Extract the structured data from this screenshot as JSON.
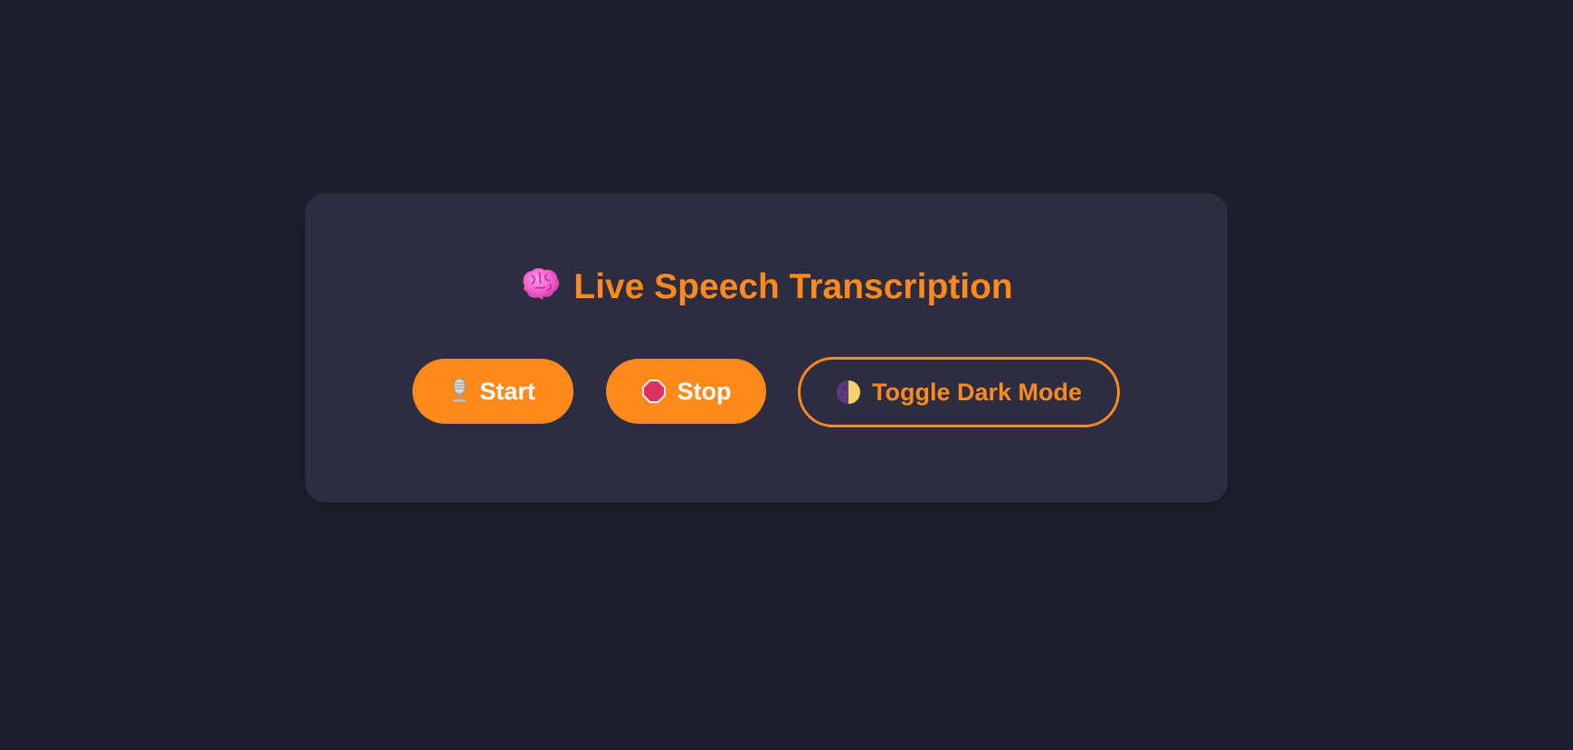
{
  "app": {
    "title": "Live Speech Transcription"
  },
  "title_icon": "brain-icon",
  "controls": {
    "start": {
      "label": "Start",
      "icon": "microphone-icon"
    },
    "stop": {
      "label": "Stop",
      "icon": "stop-sign-icon"
    },
    "toggle": {
      "label": "Toggle Dark Mode",
      "icon": "half-moon-icon"
    }
  },
  "colors": {
    "background": "#1f1f2e",
    "card": "#2d2c40",
    "accent": "#ff8a1f",
    "button_text": "#ffffff"
  }
}
